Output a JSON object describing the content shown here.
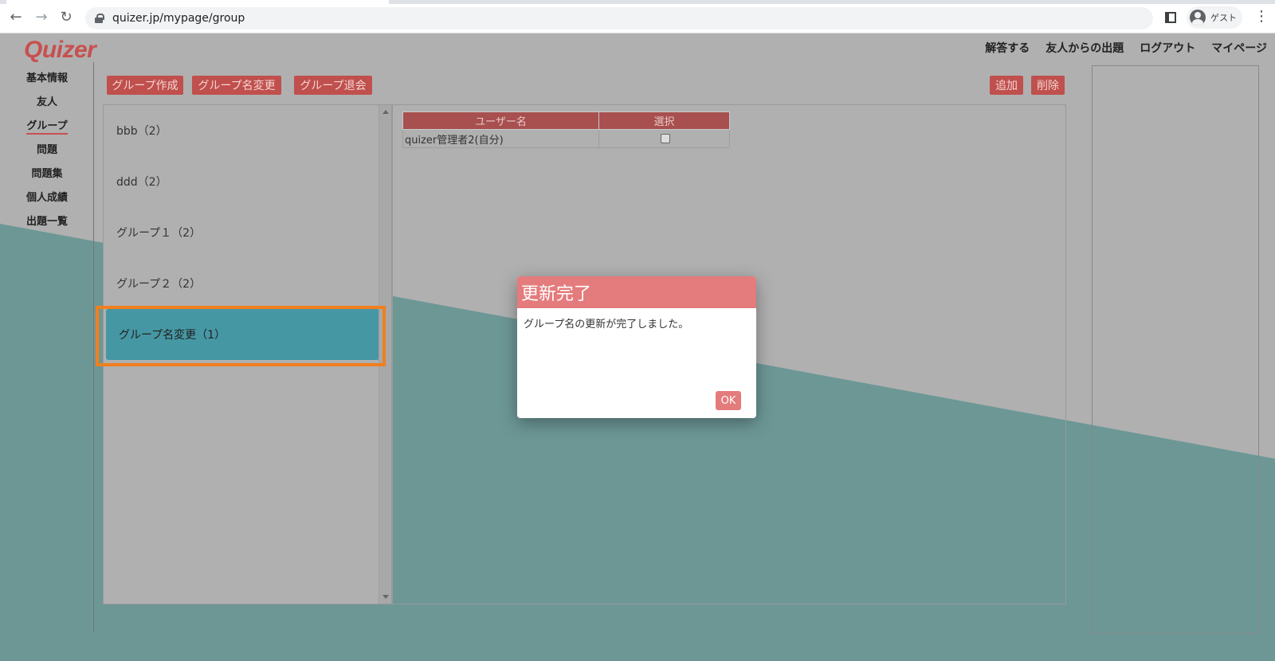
{
  "browser": {
    "url": "quizer.jp/mypage/group",
    "profile_name": "ゲスト"
  },
  "header": {
    "logo": "Quizer",
    "nav": [
      "解答する",
      "友人からの出題",
      "ログアウト",
      "マイページ"
    ]
  },
  "sidebar": {
    "items": [
      {
        "label": "基本情報"
      },
      {
        "label": "友人"
      },
      {
        "label": "グループ",
        "active": true
      },
      {
        "label": "問題"
      },
      {
        "label": "問題集"
      },
      {
        "label": "個人成績"
      },
      {
        "label": "出題一覧"
      }
    ]
  },
  "toolbar": {
    "create_label": "グループ作成",
    "rename_label": "グループ名変更",
    "leave_label": "グループ退会",
    "add_label": "追加",
    "delete_label": "削除"
  },
  "groups": [
    {
      "label": "bbb（2）"
    },
    {
      "label": "ddd（2）"
    },
    {
      "label": "グループ１（2）"
    },
    {
      "label": "グループ２（2）"
    },
    {
      "label": "グループ名変更（1）",
      "selected": true
    }
  ],
  "members_table": {
    "headers": [
      "ユーザー名",
      "選択"
    ],
    "rows": [
      {
        "username": "quizer管理者2(自分)",
        "selected": false
      }
    ]
  },
  "dialog": {
    "title": "更新完了",
    "message": "グループ名の更新が完了しました。",
    "ok_label": "OK"
  },
  "colors": {
    "accent_red": "#c0504d",
    "dialog_header": "#e47b7c",
    "selected_teal": "#4697a4",
    "background_teal": "#6c9795",
    "highlight_orange": "#f07f1e"
  }
}
